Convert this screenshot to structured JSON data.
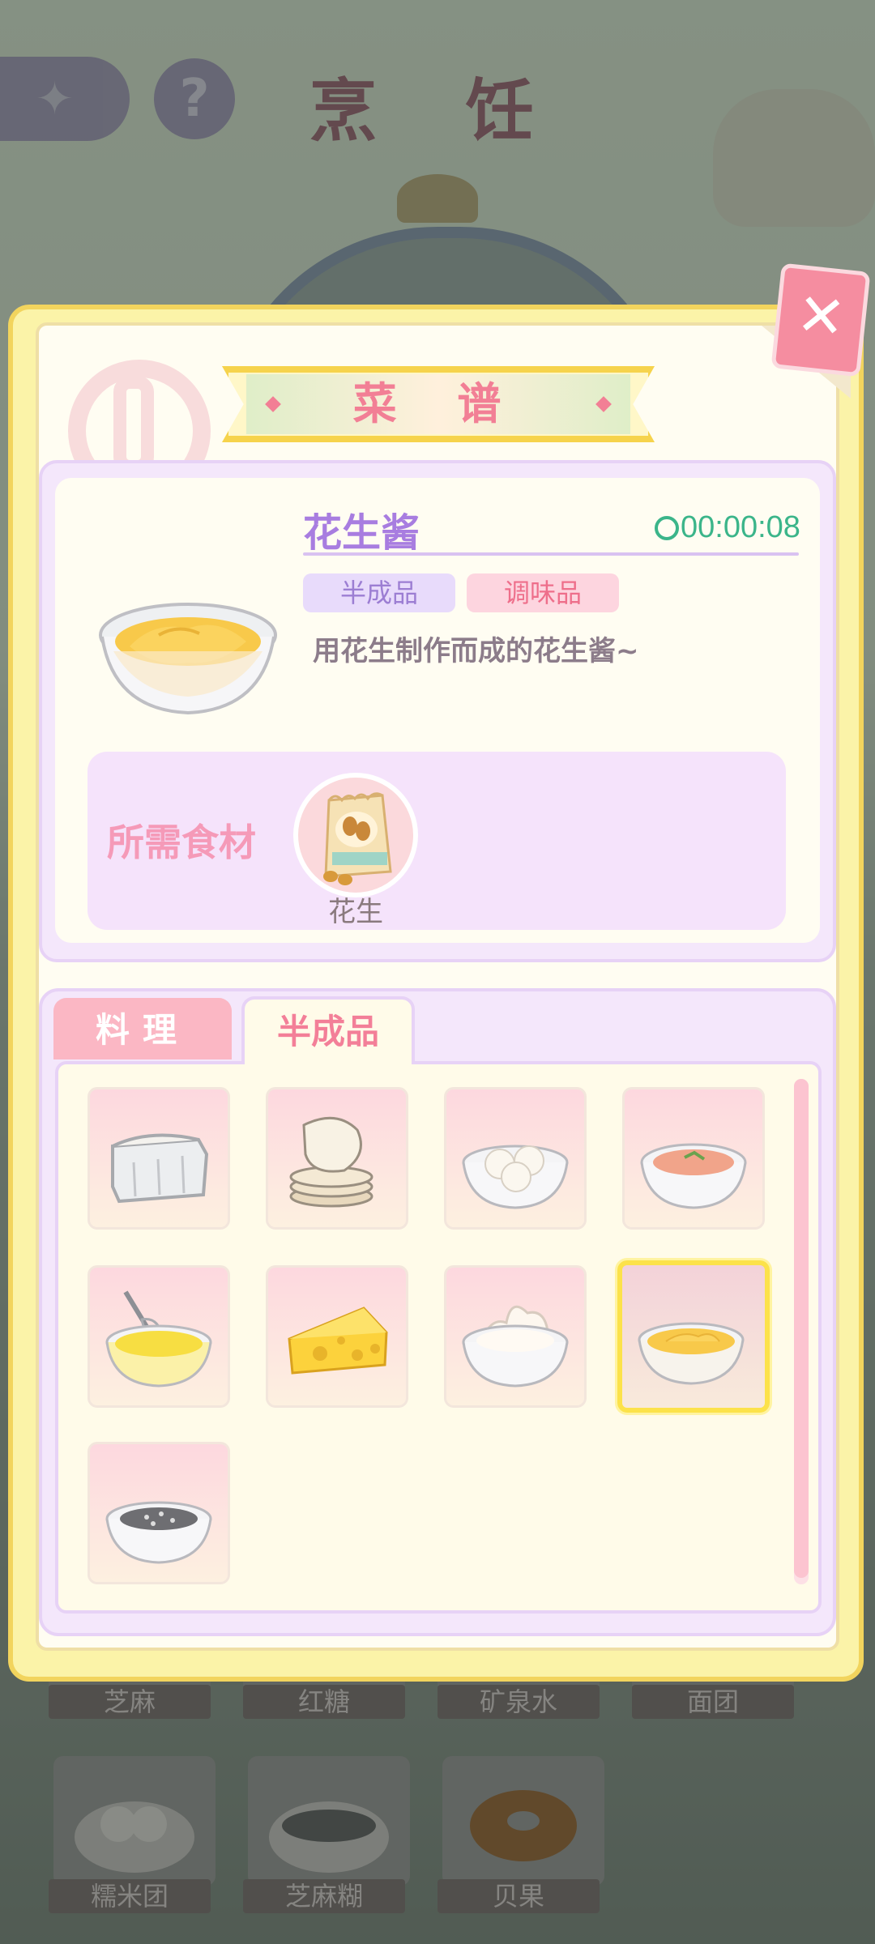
{
  "background": {
    "title": "烹 饪",
    "back_icon": "back-arrow-icon",
    "help_label": "?",
    "items": [
      {
        "label": "芝麻"
      },
      {
        "label": "红糖"
      },
      {
        "label": "矿泉水"
      },
      {
        "label": "面团"
      },
      {
        "label": "糯米团"
      },
      {
        "label": "芝麻糊"
      },
      {
        "label": "贝果"
      }
    ]
  },
  "panel": {
    "title": "菜 谱",
    "close_icon": "close-icon",
    "recipe": {
      "name": "花生酱",
      "timer": "00:00:08",
      "tags": [
        "半成品",
        "调味品"
      ],
      "description": "用花生制作而成的花生酱~",
      "ingredients_label": "所需食材",
      "ingredients": [
        {
          "name": "花生",
          "icon": "peanut-bag-icon"
        }
      ]
    },
    "tabs": [
      {
        "label": "料理",
        "active": false
      },
      {
        "label": "半成品",
        "active": true
      }
    ],
    "items": [
      {
        "icon": "bread-loaf-icon",
        "selected": false
      },
      {
        "icon": "flatbread-stack-icon",
        "selected": false
      },
      {
        "icon": "dumpling-bowl-icon",
        "selected": false
      },
      {
        "icon": "shrimp-paste-bowl-icon",
        "selected": false
      },
      {
        "icon": "whisked-egg-bowl-icon",
        "selected": false
      },
      {
        "icon": "cheese-icon",
        "selected": false
      },
      {
        "icon": "whipped-cream-bowl-icon",
        "selected": false
      },
      {
        "icon": "peanut-butter-bowl-icon",
        "selected": true
      },
      {
        "icon": "sesame-bowl-icon",
        "selected": false
      }
    ]
  },
  "colors": {
    "accent_pink": "#f27f95",
    "accent_purple": "#a87de0",
    "timer_green": "#3bb58a",
    "panel_yellow": "#f2d45d"
  }
}
